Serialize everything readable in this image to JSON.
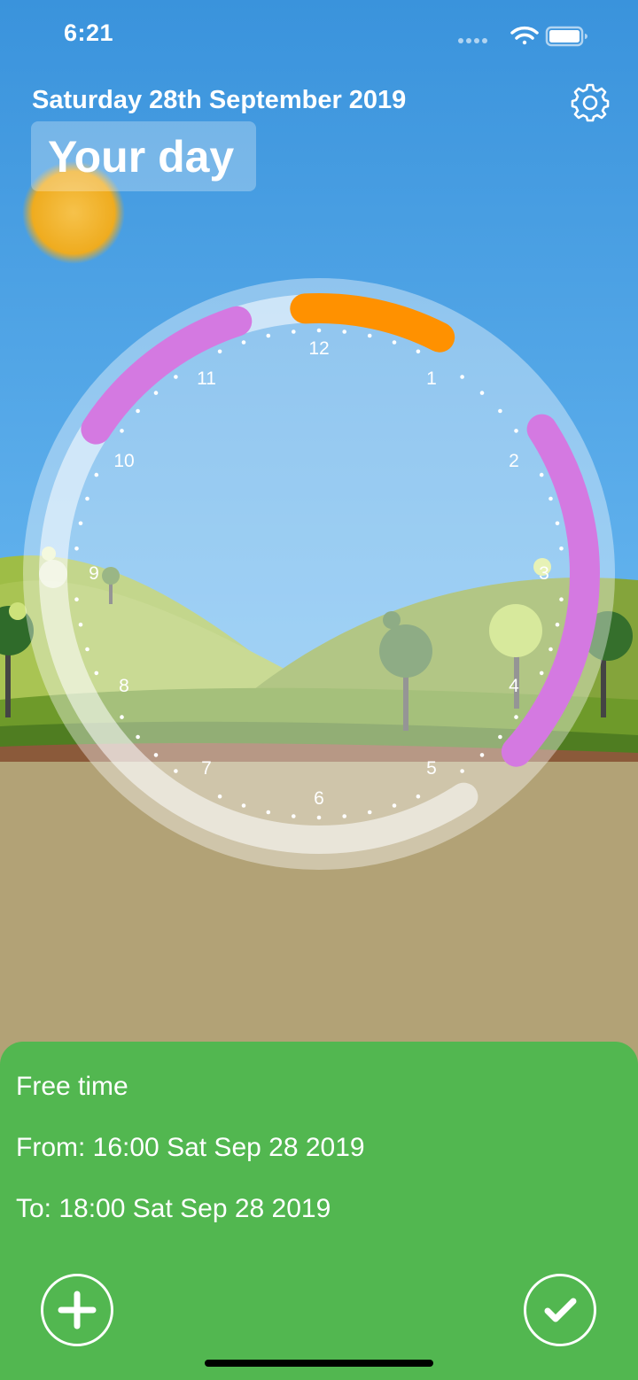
{
  "status_bar": {
    "time": "6:21"
  },
  "header": {
    "date": "Saturday 28th September 2019",
    "title": "Your day",
    "settings_icon": "gear-icon"
  },
  "clock": {
    "hour_labels": [
      "12",
      "1",
      "2",
      "3",
      "4",
      "5",
      "6",
      "7",
      "8",
      "9",
      "10",
      "11"
    ],
    "arcs": [
      {
        "color": "#ff9100",
        "start_hour": 11.9,
        "end_hour": 0.9
      },
      {
        "color": "#d479e1",
        "start_hour": 10.1,
        "end_hour": 11.4
      },
      {
        "color": "#d479e1",
        "start_hour": 1.9,
        "end_hour": 4.4
      }
    ],
    "progress_track": {
      "color": "#ffffff"
    }
  },
  "detail": {
    "name": "Free time",
    "from": "From: 16:00 Sat Sep 28 2019",
    "to": "To: 18:00 Sat Sep 28 2019",
    "add_icon": "plus-icon",
    "confirm_icon": "checkmark-icon"
  },
  "colors": {
    "sky": "#3c95dd",
    "panel": "#52b750",
    "orange": "#ff9100",
    "purple": "#d479e1"
  }
}
